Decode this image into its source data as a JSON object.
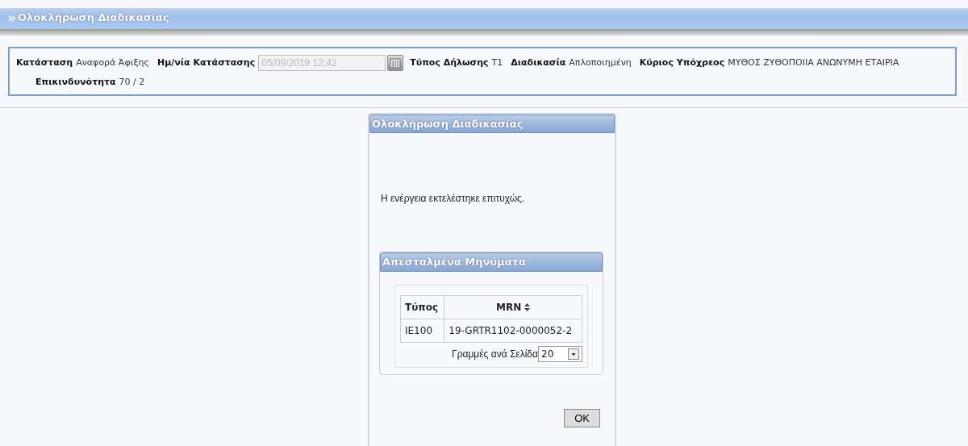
{
  "header": {
    "title": "Ολοκλήρωση Διαδικασίας"
  },
  "status_fields": [
    {
      "kind": "text",
      "label": "Κατάσταση",
      "value": "Αναφορά Άφιξης"
    },
    {
      "kind": "date",
      "label": "Ημ/νία Κατάστασης",
      "value": "05/09/2019 12:42",
      "disabled": true
    },
    {
      "kind": "text",
      "label": "Τύπος Δήλωσης",
      "value": "T1"
    },
    {
      "kind": "text",
      "label": "Διαδικασία",
      "value": "Απλοποιημένη"
    },
    {
      "kind": "text",
      "label": "Κύριος Υπόχρεος",
      "value": "ΜΥΘΟΣ ΖΥΘΟΠΟΙΙΑ ΑΝΩΝΥΜΗ ΕΤΑΙΡΙΑ"
    },
    {
      "kind": "text",
      "label": "Επικινδυνότητα",
      "value": "70 / 2"
    }
  ],
  "dialog": {
    "title": "Ολοκλήρωση Διαδικασίας",
    "message": "Η ενέργεια εκτελέστηκε επιτυχώς.",
    "messages_panel": {
      "title": "Απεσταλμένα Μηνύματα",
      "columns": [
        {
          "label": "Τύπος",
          "sortable": false
        },
        {
          "label": "MRN",
          "sortable": true
        }
      ],
      "rows": [
        [
          "IE100",
          "19-GRTR1102-0000052-2"
        ]
      ],
      "rows_per_page_label": "Γραμμές ανά Σελίδα",
      "rows_per_page": "20"
    },
    "ok_button": "OK"
  }
}
